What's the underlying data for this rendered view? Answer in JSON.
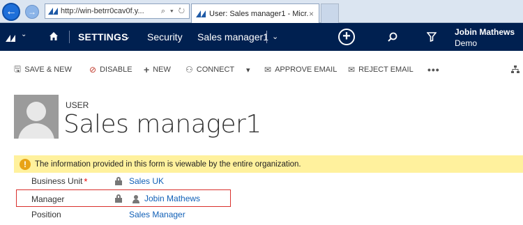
{
  "browser": {
    "back_label": "←",
    "forward_label": "→",
    "url": "http://win-betrr0cav0f.y...",
    "address_icons": "⌕ ▾ ↻",
    "tab_title": "User: Sales manager1 - Micr...",
    "tab_close": "×"
  },
  "nav": {
    "settings_label": "SETTINGS",
    "settings_chevron": "⌄",
    "security_label": "Security",
    "record_label": "Sales manager1",
    "record_chevron": "⌄",
    "create_label": "+",
    "user_name": "Jobin Mathews",
    "user_org": "Demo"
  },
  "commands": {
    "save_new": "SAVE & NEW",
    "disable": "DISABLE",
    "new": "NEW",
    "connect": "CONNECT",
    "connect_drop": "▾",
    "approve_email": "APPROVE EMAIL",
    "reject_email": "REJECT EMAIL",
    "more": "•••"
  },
  "header": {
    "entity_type": "USER",
    "record_title": "Sales manager1"
  },
  "notification": {
    "icon": "!",
    "text": "The information provided in this form is viewable by the entire organization."
  },
  "form": {
    "business_unit_label": "Business Unit",
    "business_unit_required": "*",
    "business_unit_value": "Sales UK",
    "manager_label": "Manager",
    "manager_value": "Jobin Mathews",
    "position_label": "Position",
    "position_value": "Sales Manager"
  },
  "colors": {
    "nav_background": "#002050",
    "link": "#1160b7",
    "notification_background": "#fff19d",
    "highlight_border": "#d9302c",
    "required": "#e00000"
  }
}
